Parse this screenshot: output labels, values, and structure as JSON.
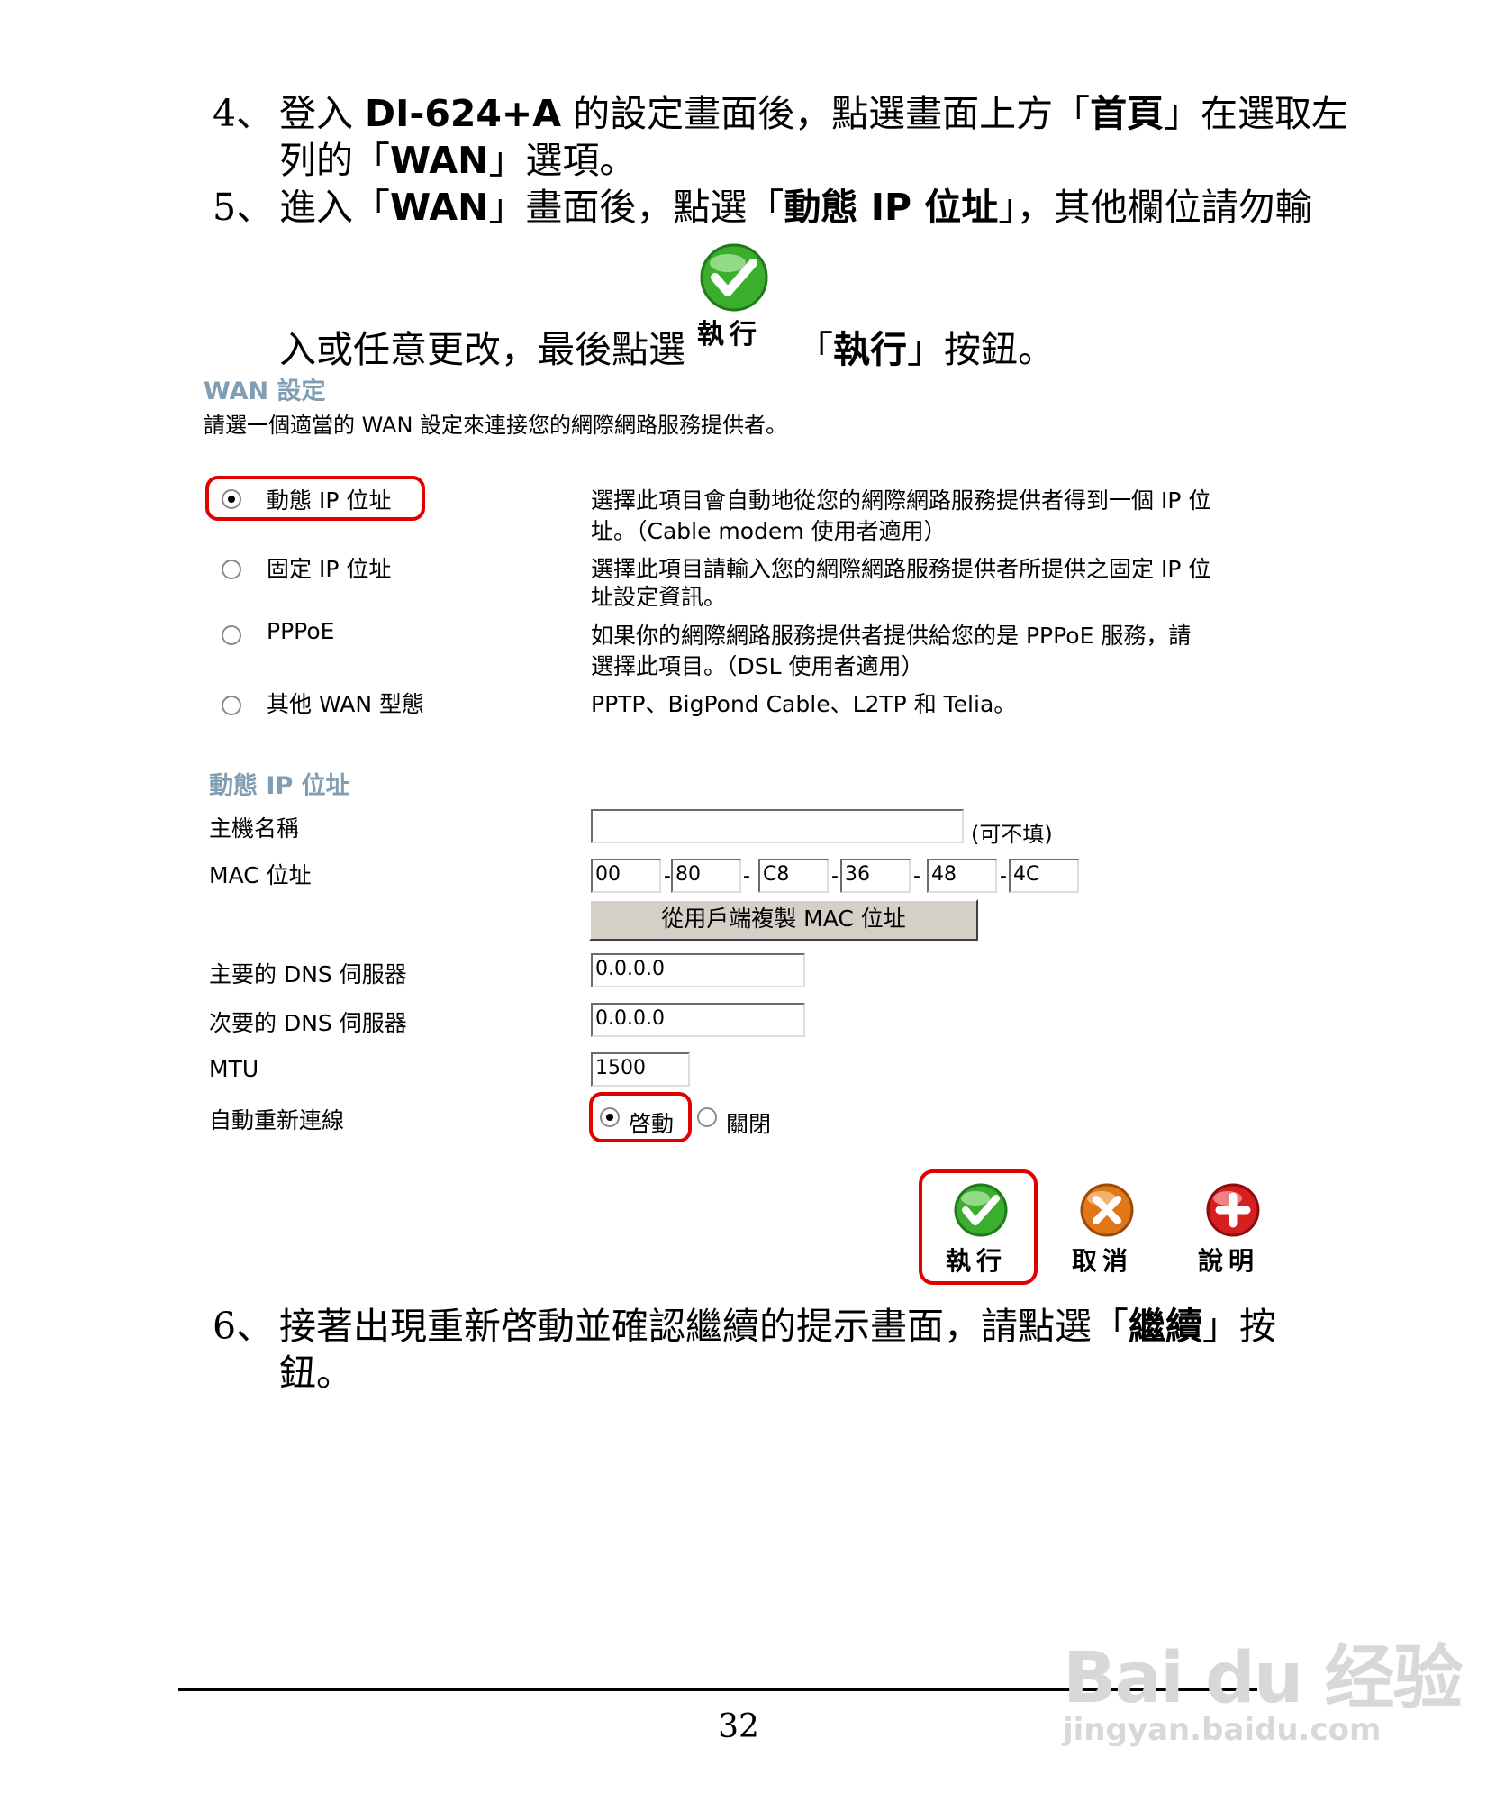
{
  "steps": [
    {
      "num": "4、",
      "line1": [
        "登入 ",
        "DI-624+A",
        " 的設定畫面後，點選畫面上方「",
        "首頁",
        "」在選取左"
      ],
      "line2": [
        "列的「",
        "WAN",
        "」選項。"
      ]
    },
    {
      "num": "5、",
      "line1": [
        "進入「",
        "WAN",
        "」畫面後，點選「",
        "動態 IP 位址",
        "」，其他欄位請勿輸"
      ],
      "line2a": "入或任意更改，最後點選",
      "line2b": [
        "「",
        "執行",
        "」按鈕。"
      ],
      "inline_icon_label": "執行"
    },
    {
      "num": "6、",
      "line1": [
        "接著出現重新啓動並確認繼續的提示畫面，請點選「",
        "繼續",
        "」按"
      ],
      "line2": "鈕。"
    }
  ],
  "ui": {
    "title": "WAN 設定",
    "subtitle": "請選一個適當的 WAN 設定來連接您的網際網路服務提供者。",
    "options": [
      {
        "label": "動態 IP 位址",
        "desc1": "選擇此項目會自動地從您的網際網路服務提供者得到一個 IP 位",
        "desc2": "址。（Cable modem 使用者適用）",
        "selected": true
      },
      {
        "label": "固定 IP 位址",
        "desc1": "選擇此項目請輸入您的網際網路服務提供者所提供之固定 IP 位",
        "desc2": "址設定資訊。",
        "selected": false
      },
      {
        "label": "PPPoE",
        "desc1": "如果你的網際網路服務提供者提供給您的是 PPPoE 服務，請",
        "desc2": "選擇此項目。（DSL 使用者適用）",
        "selected": false
      },
      {
        "label": "其他 WAN 型態",
        "desc1": "PPTP、BigPond Cable、L2TP 和 Telia。",
        "desc2": "",
        "selected": false
      }
    ],
    "section_title": "動態 IP 位址",
    "fields": {
      "host_label": "主機名稱",
      "host_value": "",
      "host_note": "(可不填)",
      "mac_label": "MAC 位址",
      "mac": [
        "00",
        "80",
        "C8",
        "36",
        "48",
        "4C"
      ],
      "mac_sep": "-",
      "clone_button": "從用戶端複製 MAC 位址",
      "dns1_label": "主要的 DNS 伺服器",
      "dns1_value": "0.0.0.0",
      "dns2_label": "次要的 DNS 伺服器",
      "dns2_value": "0.0.0.0",
      "mtu_label": "MTU",
      "mtu_value": "1500",
      "reconnect_label": "自動重新連線",
      "reconnect_on": "啓動",
      "reconnect_off": "關閉"
    },
    "actions": {
      "apply": "執行",
      "cancel": "取消",
      "help": "說明"
    }
  },
  "page_number": "32",
  "watermark": {
    "brand": "Bai du 经验",
    "url": "jingyan.baidu.com"
  },
  "colors": {
    "red": "#e00000",
    "heading": "#7f9db3",
    "apply_green": "#3cae2e",
    "cancel_orange": "#e07818",
    "help_red": "#d62020"
  }
}
